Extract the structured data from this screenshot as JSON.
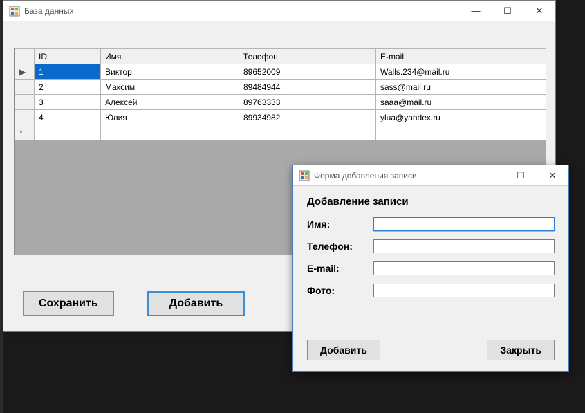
{
  "main_window": {
    "title": "База данных",
    "buttons": {
      "save": "Сохранить",
      "add": "Добавить"
    }
  },
  "grid": {
    "columns": [
      "ID",
      "Имя",
      "Телефон",
      "E-mail"
    ],
    "rows": [
      {
        "id": "1",
        "name": "Виктор",
        "tel": "89652009",
        "mail": "Walls.234@mail.ru"
      },
      {
        "id": "2",
        "name": "Максим",
        "tel": "89484944",
        "mail": "sass@mail.ru"
      },
      {
        "id": "3",
        "name": "Алексей",
        "tel": "89763333",
        "mail": "saaa@mail.ru"
      },
      {
        "id": "4",
        "name": "Юлия",
        "tel": "89934982",
        "mail": "ylua@yandex.ru"
      }
    ],
    "selected_row_index": 0,
    "current_row_indicator": "▶",
    "new_row_indicator": "*"
  },
  "dialog": {
    "title": "Форма добавления записи",
    "heading": "Добавление записи",
    "fields": {
      "name": {
        "label": "Имя:",
        "value": ""
      },
      "tel": {
        "label": "Телефон:",
        "value": ""
      },
      "email": {
        "label": "E-mail:",
        "value": ""
      },
      "photo": {
        "label": "Фото:",
        "value": ""
      }
    },
    "buttons": {
      "add": "Добавить",
      "close": "Закрыть"
    }
  },
  "win_controls": {
    "minimize": "—",
    "maximize": "☐",
    "close": "✕"
  }
}
